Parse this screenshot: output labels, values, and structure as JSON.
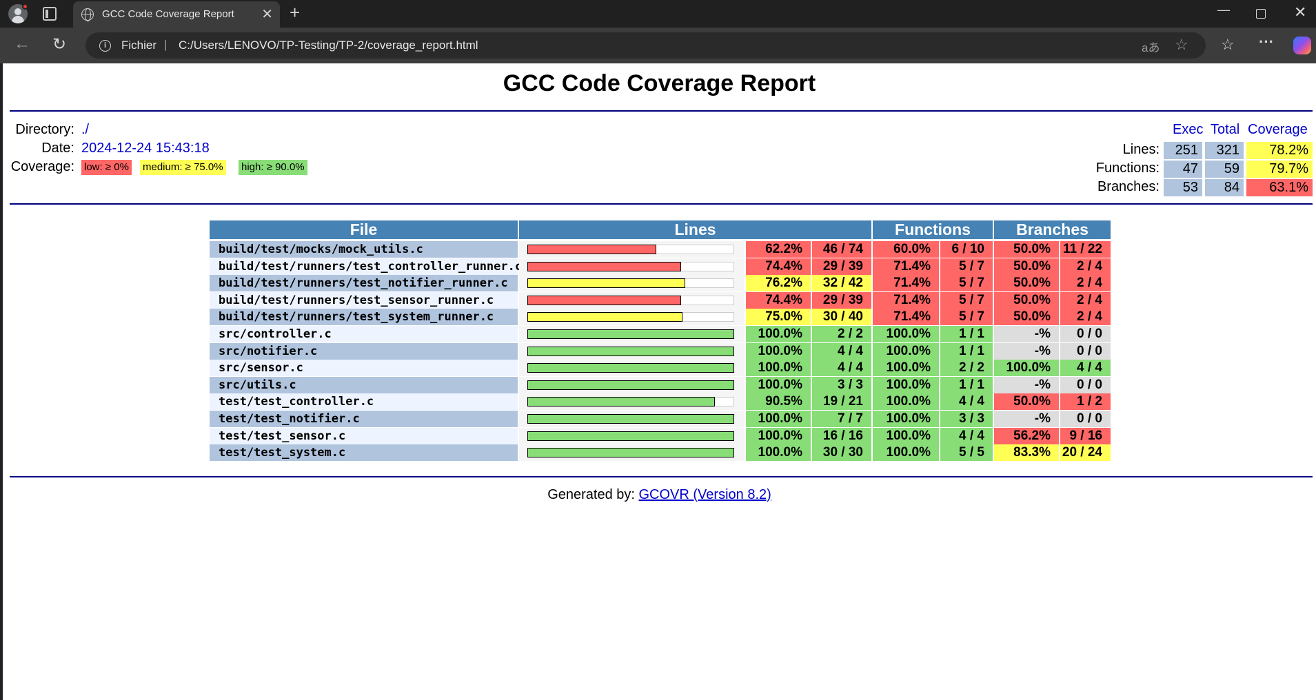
{
  "browser": {
    "tab_title": "GCC Code Coverage Report",
    "address_scheme": "Fichier",
    "address_separator": "|",
    "url": "C:/Users/LENOVO/TP-Testing/TP-2/coverage_report.html",
    "read_aloud": "aあ"
  },
  "page": {
    "title": "GCC Code Coverage Report",
    "directory_label": "Directory:",
    "directory_value": "./",
    "date_label": "Date:",
    "date_value": "2024-12-24 15:43:18",
    "coverage_label": "Coverage:",
    "legend": {
      "low": "low: ≥ 0%",
      "medium": "medium: ≥ 75.0%",
      "high": "high: ≥ 90.0%"
    }
  },
  "summary": {
    "headers": {
      "exec": "Exec",
      "total": "Total",
      "coverage": "Coverage"
    },
    "lines": {
      "label": "Lines:",
      "exec": "251",
      "total": "321",
      "coverage": "78.2%",
      "level": "medium"
    },
    "functions": {
      "label": "Functions:",
      "exec": "47",
      "total": "59",
      "coverage": "79.7%",
      "level": "medium"
    },
    "branches": {
      "label": "Branches:",
      "exec": "53",
      "total": "84",
      "coverage": "63.1%",
      "level": "low"
    }
  },
  "colors": {
    "low": "#ff6666",
    "medium": "#ffff55",
    "high": "#88dd77",
    "unknown": "#dddddd",
    "header_bg": "#4682b4",
    "summary_bg": "#b0c4de",
    "row_even": "#b0c4de",
    "row_odd": "#eef4ff"
  },
  "table": {
    "headers": {
      "file": "File",
      "lines": "Lines",
      "functions": "Functions",
      "branches": "Branches"
    },
    "rows": [
      {
        "file": "build/test/mocks/mock_utils.c",
        "lines_pct": "62.2%",
        "lines_frac": "46 / 74",
        "lines_ratio": 0.622,
        "lines_level": "low",
        "func_pct": "60.0%",
        "func_frac": "6 / 10",
        "func_level": "low",
        "branch_pct": "50.0%",
        "branch_frac": "11 / 22",
        "branch_level": "low"
      },
      {
        "file": "build/test/runners/test_controller_runner.c",
        "lines_pct": "74.4%",
        "lines_frac": "29 / 39",
        "lines_ratio": 0.744,
        "lines_level": "low",
        "func_pct": "71.4%",
        "func_frac": "5 / 7",
        "func_level": "low",
        "branch_pct": "50.0%",
        "branch_frac": "2 / 4",
        "branch_level": "low"
      },
      {
        "file": "build/test/runners/test_notifier_runner.c",
        "lines_pct": "76.2%",
        "lines_frac": "32 / 42",
        "lines_ratio": 0.762,
        "lines_level": "medium",
        "func_pct": "71.4%",
        "func_frac": "5 / 7",
        "func_level": "low",
        "branch_pct": "50.0%",
        "branch_frac": "2 / 4",
        "branch_level": "low"
      },
      {
        "file": "build/test/runners/test_sensor_runner.c",
        "lines_pct": "74.4%",
        "lines_frac": "29 / 39",
        "lines_ratio": 0.744,
        "lines_level": "low",
        "func_pct": "71.4%",
        "func_frac": "5 / 7",
        "func_level": "low",
        "branch_pct": "50.0%",
        "branch_frac": "2 / 4",
        "branch_level": "low"
      },
      {
        "file": "build/test/runners/test_system_runner.c",
        "lines_pct": "75.0%",
        "lines_frac": "30 / 40",
        "lines_ratio": 0.75,
        "lines_level": "medium",
        "func_pct": "71.4%",
        "func_frac": "5 / 7",
        "func_level": "low",
        "branch_pct": "50.0%",
        "branch_frac": "2 / 4",
        "branch_level": "low"
      },
      {
        "file": "src/controller.c",
        "lines_pct": "100.0%",
        "lines_frac": "2 / 2",
        "lines_ratio": 1.0,
        "lines_level": "high",
        "func_pct": "100.0%",
        "func_frac": "1 / 1",
        "func_level": "high",
        "branch_pct": "-%",
        "branch_frac": "0 / 0",
        "branch_level": "unknown"
      },
      {
        "file": "src/notifier.c",
        "lines_pct": "100.0%",
        "lines_frac": "4 / 4",
        "lines_ratio": 1.0,
        "lines_level": "high",
        "func_pct": "100.0%",
        "func_frac": "1 / 1",
        "func_level": "high",
        "branch_pct": "-%",
        "branch_frac": "0 / 0",
        "branch_level": "unknown"
      },
      {
        "file": "src/sensor.c",
        "lines_pct": "100.0%",
        "lines_frac": "4 / 4",
        "lines_ratio": 1.0,
        "lines_level": "high",
        "func_pct": "100.0%",
        "func_frac": "2 / 2",
        "func_level": "high",
        "branch_pct": "100.0%",
        "branch_frac": "4 / 4",
        "branch_level": "high"
      },
      {
        "file": "src/utils.c",
        "lines_pct": "100.0%",
        "lines_frac": "3 / 3",
        "lines_ratio": 1.0,
        "lines_level": "high",
        "func_pct": "100.0%",
        "func_frac": "1 / 1",
        "func_level": "high",
        "branch_pct": "-%",
        "branch_frac": "0 / 0",
        "branch_level": "unknown"
      },
      {
        "file": "test/test_controller.c",
        "lines_pct": "90.5%",
        "lines_frac": "19 / 21",
        "lines_ratio": 0.905,
        "lines_level": "high",
        "func_pct": "100.0%",
        "func_frac": "4 / 4",
        "func_level": "high",
        "branch_pct": "50.0%",
        "branch_frac": "1 / 2",
        "branch_level": "low"
      },
      {
        "file": "test/test_notifier.c",
        "lines_pct": "100.0%",
        "lines_frac": "7 / 7",
        "lines_ratio": 1.0,
        "lines_level": "high",
        "func_pct": "100.0%",
        "func_frac": "3 / 3",
        "func_level": "high",
        "branch_pct": "-%",
        "branch_frac": "0 / 0",
        "branch_level": "unknown"
      },
      {
        "file": "test/test_sensor.c",
        "lines_pct": "100.0%",
        "lines_frac": "16 / 16",
        "lines_ratio": 1.0,
        "lines_level": "high",
        "func_pct": "100.0%",
        "func_frac": "4 / 4",
        "func_level": "high",
        "branch_pct": "56.2%",
        "branch_frac": "9 / 16",
        "branch_level": "low"
      },
      {
        "file": "test/test_system.c",
        "lines_pct": "100.0%",
        "lines_frac": "30 / 30",
        "lines_ratio": 1.0,
        "lines_level": "high",
        "func_pct": "100.0%",
        "func_frac": "5 / 5",
        "func_level": "high",
        "branch_pct": "83.3%",
        "branch_frac": "20 / 24",
        "branch_level": "medium"
      }
    ]
  },
  "footer": {
    "prefix": "Generated by:",
    "link": "GCOVR (Version 8.2)"
  }
}
